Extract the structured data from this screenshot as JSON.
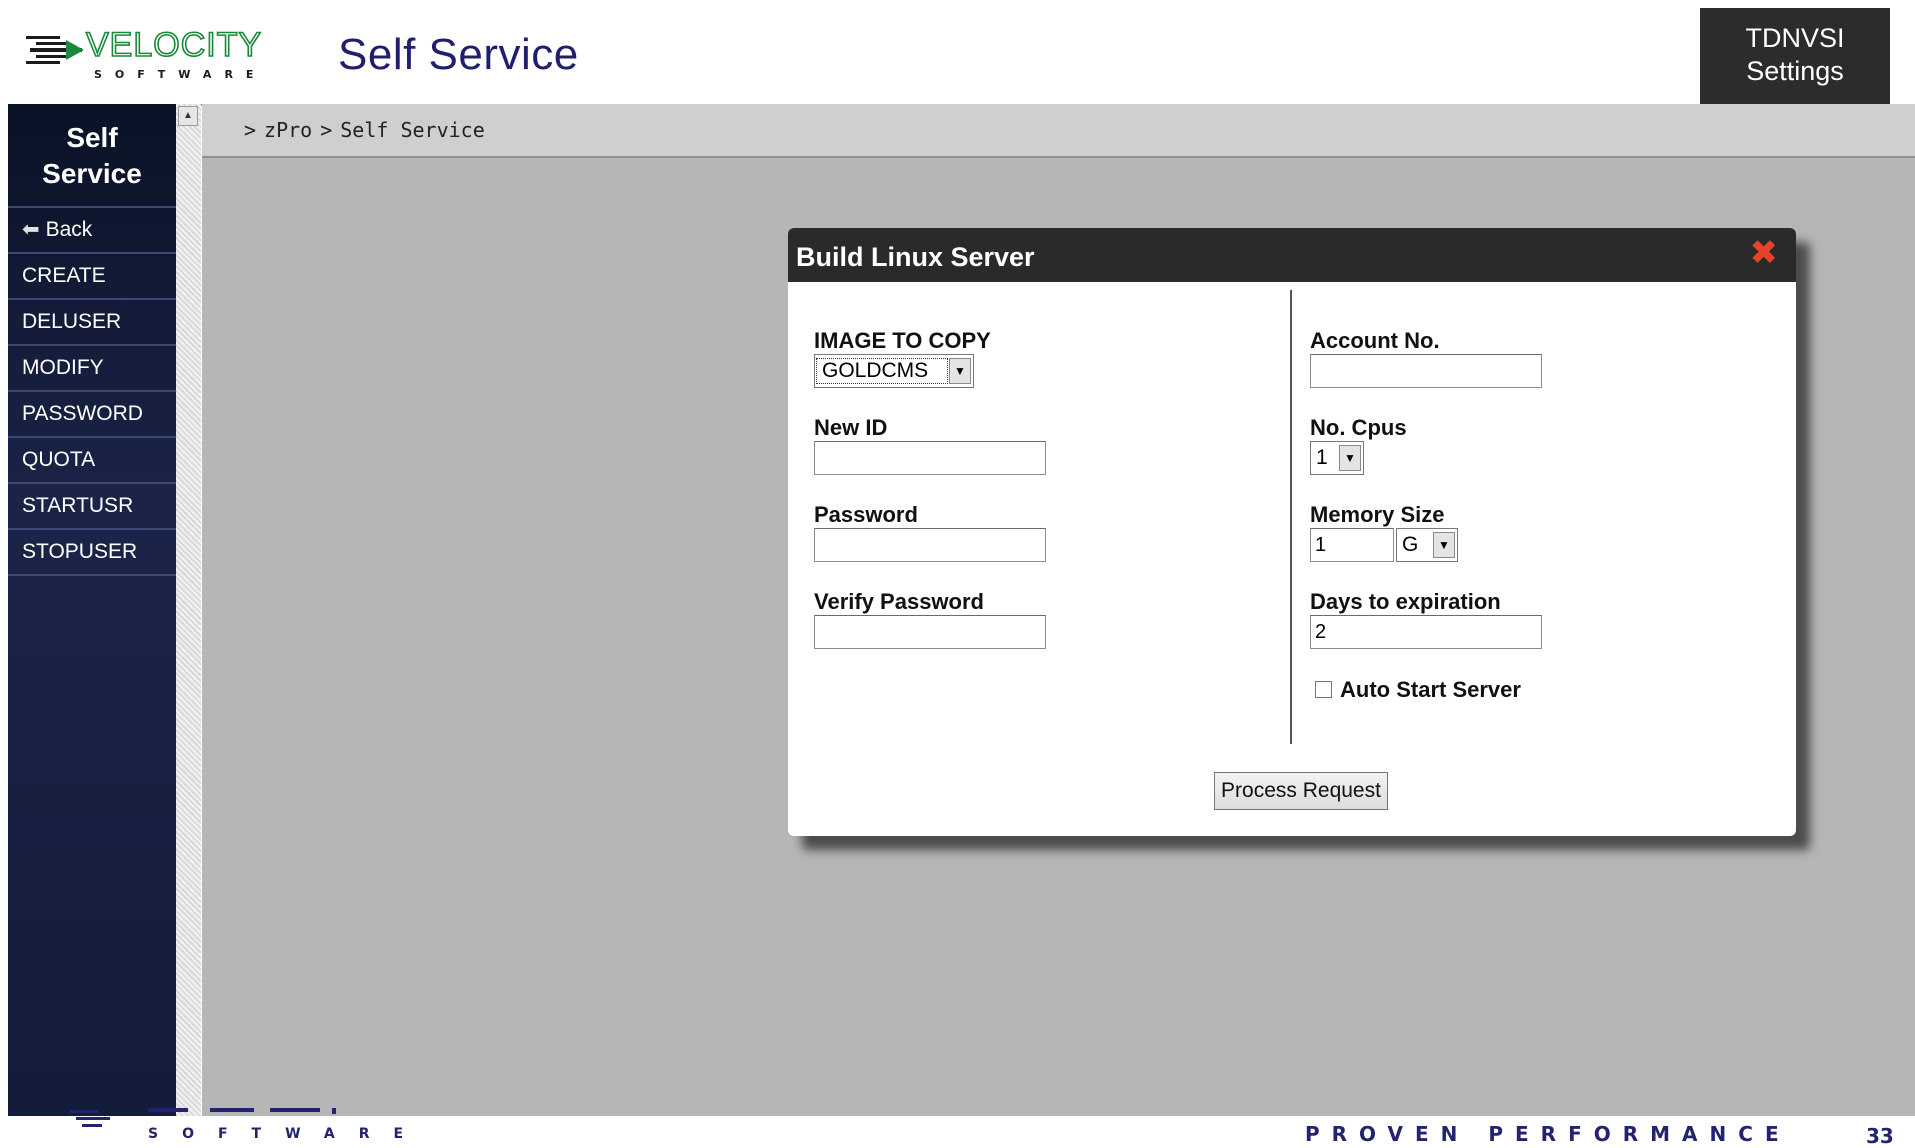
{
  "header": {
    "logo_text": "VELOCITY",
    "logo_subtext": "SOFTWARE",
    "app_title": "Self Service",
    "settings_button": [
      "TDNVSI",
      "Settings"
    ]
  },
  "sidebar": {
    "title": [
      "Self",
      "Service"
    ],
    "back_label": "Back",
    "items": [
      {
        "label": "CREATE"
      },
      {
        "label": "DELUSER"
      },
      {
        "label": "MODIFY"
      },
      {
        "label": "PASSWORD"
      },
      {
        "label": "QUOTA"
      },
      {
        "label": "STARTUSR"
      },
      {
        "label": "STOPUSER"
      }
    ]
  },
  "breadcrumb": {
    "items": [
      "zPro",
      "Self Service"
    ],
    "separator": ">"
  },
  "dialog": {
    "title": "Build Linux Server",
    "left": {
      "image_label": "IMAGE TO COPY",
      "image_value": "GOLDCMS",
      "new_id_label": "New ID",
      "new_id_value": "",
      "password_label": "Password",
      "password_value": "",
      "verify_label": "Verify Password",
      "verify_value": ""
    },
    "right": {
      "account_label": "Account No.",
      "account_value": "",
      "cpus_label": "No. Cpus",
      "cpus_value": "1",
      "memory_label": "Memory Size",
      "memory_value": "1",
      "memory_unit": "G",
      "days_label": "Days to expiration",
      "days_value": "2",
      "auto_start_label": "Auto Start Server",
      "auto_start_checked": false
    },
    "submit_label": "Process Request"
  },
  "footer": {
    "tagline": "PROVEN PERFORMANCE",
    "page_number": "33"
  },
  "colors": {
    "sidebar_bg": "#141c3c",
    "content_bg": "#b6b6b6",
    "dialog_title_bg": "#2a2a2a",
    "close_red": "#e8412c",
    "logo_green": "#1a8a3a",
    "title_navy": "#1f1f6e"
  }
}
